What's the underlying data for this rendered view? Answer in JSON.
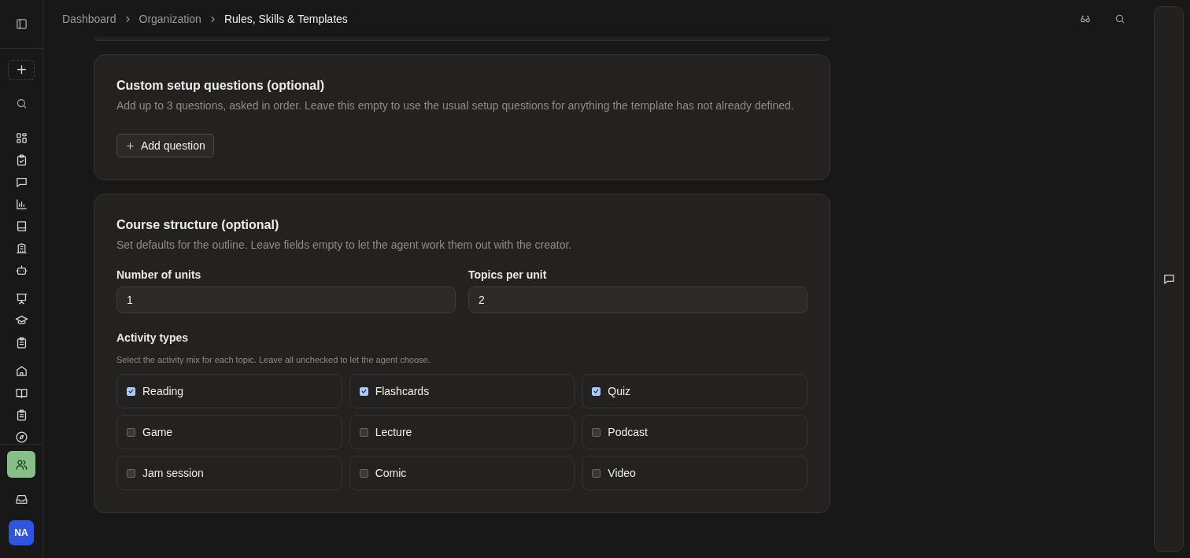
{
  "user": {
    "initials": "NA"
  },
  "breadcrumb": [
    {
      "label": "Dashboard",
      "current": false
    },
    {
      "label": "Organization",
      "current": false
    },
    {
      "label": "Rules, Skills & Templates",
      "current": true
    }
  ],
  "sidebar": {
    "bottom": [
      {
        "selected": true
      },
      {
        "selected": false
      }
    ]
  },
  "questions": {
    "title": "Custom setup questions (optional)",
    "description": "Add up to 3 questions, asked in order. Leave this empty to use the usual setup questions for anything the template has not already defined.",
    "button": "Add question"
  },
  "structure": {
    "title": "Course structure (optional)",
    "description": "Set defaults for the outline. Leave fields empty to let the agent work them out with the creator.",
    "fields": [
      {
        "label": "Number of units",
        "value": "1"
      },
      {
        "label": "Topics per unit",
        "value": "2"
      }
    ],
    "activity_title": "Activity types",
    "activity_hint": "Select the activity mix for each topic. Leave all unchecked to let the agent choose.",
    "activities": [
      {
        "label": "Reading",
        "checked": true
      },
      {
        "label": "Flashcards",
        "checked": true
      },
      {
        "label": "Quiz",
        "checked": true
      },
      {
        "label": "Game",
        "checked": false
      },
      {
        "label": "Lecture",
        "checked": false
      },
      {
        "label": "Podcast",
        "checked": false
      },
      {
        "label": "Jam session",
        "checked": false
      },
      {
        "label": "Comic",
        "checked": false
      },
      {
        "label": "Video",
        "checked": false
      }
    ]
  }
}
